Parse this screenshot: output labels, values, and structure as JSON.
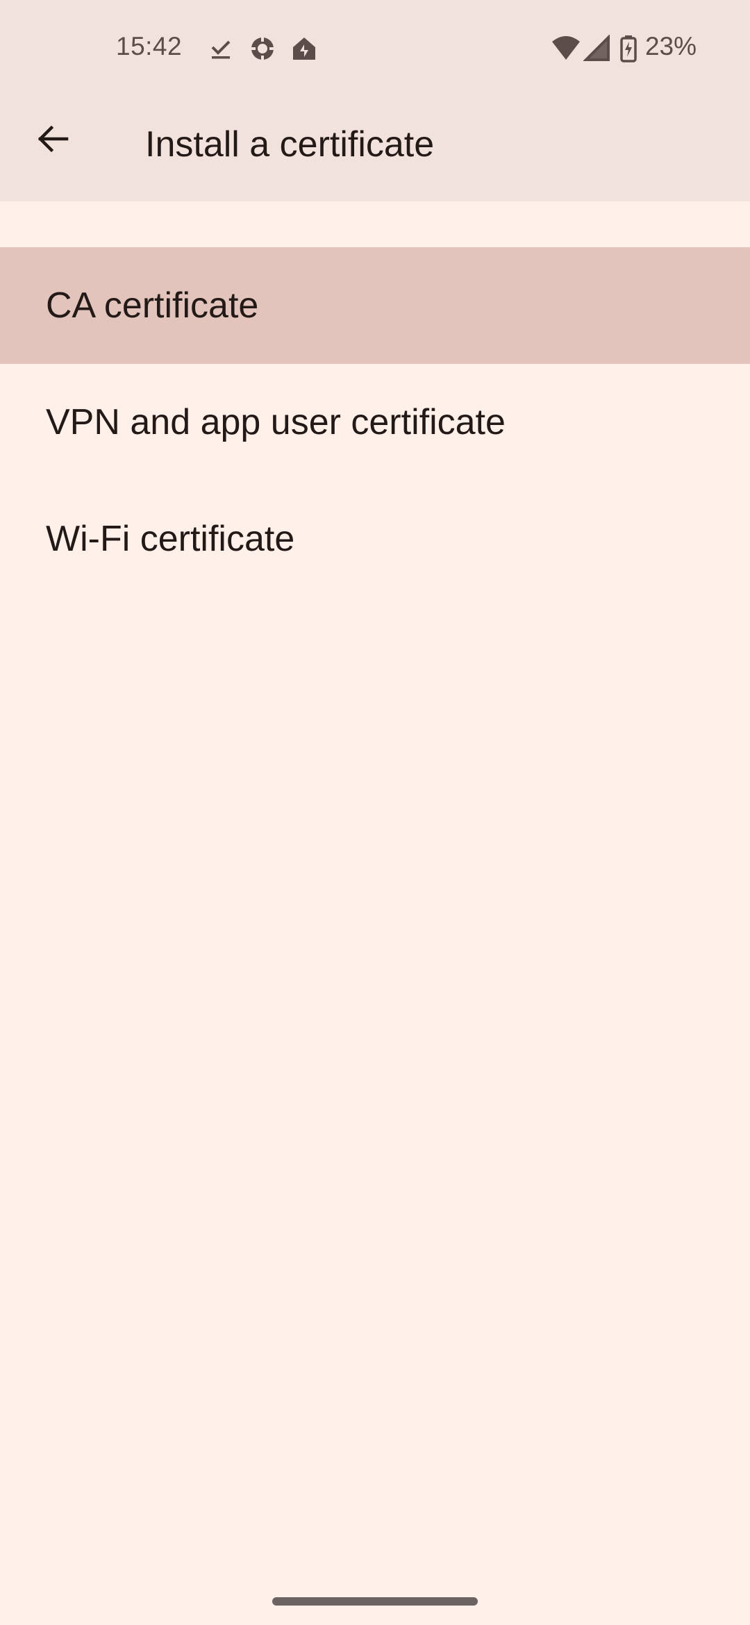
{
  "status_bar": {
    "time": "15:42",
    "battery_percent": "23%",
    "left_icons": [
      "download-done-icon",
      "crosshair-app-icon",
      "home-app-icon"
    ],
    "right_icons": [
      "wifi-icon",
      "cellular-signal-icon",
      "battery-charging-icon"
    ]
  },
  "app_bar": {
    "title": "Install a certificate",
    "back_icon": "arrow-back-icon"
  },
  "list": {
    "items": [
      {
        "label": "CA certificate",
        "selected": true
      },
      {
        "label": "VPN and app user certificate",
        "selected": false
      },
      {
        "label": "Wi-Fi certificate",
        "selected": false
      }
    ]
  },
  "colors": {
    "background": "#fff0ea",
    "app_bar": "#f1e2de",
    "selected_row": "#e2c4bc",
    "text": "#231917"
  }
}
